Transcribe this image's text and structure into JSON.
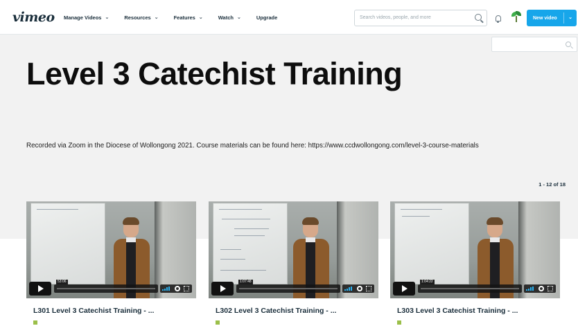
{
  "app": {
    "logo": "vimeo"
  },
  "nav": {
    "items": [
      {
        "label": "Manage Videos",
        "dropdown": true
      },
      {
        "label": "Resources",
        "dropdown": true
      },
      {
        "label": "Features",
        "dropdown": true
      },
      {
        "label": "Watch",
        "dropdown": true
      },
      {
        "label": "Upgrade",
        "dropdown": false
      }
    ],
    "search_placeholder": "Search videos, people, and more",
    "new_video_label": "New video",
    "icons": [
      "search-icon",
      "bell-icon",
      "avatar",
      "chevron-down-icon"
    ],
    "accent_color": "#17a6ea"
  },
  "showcase": {
    "title": "Level 3 Catechist Training",
    "description": "Recorded via Zoom in the Diocese of Wollongong 2021. Course materials can be found here: https://www.ccdwollongong.com/level-3-course-materials",
    "count": "1 - 12 of 18"
  },
  "videos": [
    {
      "title": "L301 Level 3 Catechist Training - ...",
      "duration": "53:06"
    },
    {
      "title": "L302 Level 3 Catechist Training - ...",
      "duration": "1:07:48"
    },
    {
      "title": "L303 Level 3 Catechist Training - ...",
      "duration": "1:04:22"
    }
  ]
}
